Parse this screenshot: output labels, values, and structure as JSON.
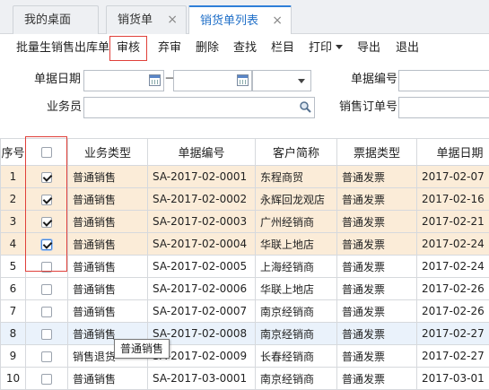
{
  "tabs": [
    {
      "label": "我的桌面"
    },
    {
      "label": "销货单",
      "close": "×"
    },
    {
      "label": "销货单列表",
      "close": "×"
    }
  ],
  "toolbar": {
    "batch_out": "批量生销售出库单",
    "audit": "审核",
    "abandon": "弃审",
    "delete": "删除",
    "find": "查找",
    "columns": "栏目",
    "print": "打印",
    "export": "导出",
    "exit": "退出"
  },
  "search": {
    "date_label": "单据日期",
    "date_sep": "－",
    "bill_no_label": "单据编号",
    "salesman_label": "业务员",
    "order_no_label": "销售订单号"
  },
  "grid": {
    "headers": [
      "序号",
      "",
      "业务类型",
      "单据编号",
      "客户简称",
      "票据类型",
      "单据日期"
    ],
    "rows": [
      {
        "no": "1",
        "checked": true,
        "type": "普通销售",
        "bill": "SA-2017-02-0001",
        "customer": "东程商贸",
        "invoice": "普通发票",
        "date": "2017-02-07"
      },
      {
        "no": "2",
        "checked": true,
        "type": "普通销售",
        "bill": "SA-2017-02-0002",
        "customer": "永辉回龙观店",
        "invoice": "普通发票",
        "date": "2017-02-16"
      },
      {
        "no": "3",
        "checked": true,
        "type": "普通销售",
        "bill": "SA-2017-02-0003",
        "customer": "广州经销商",
        "invoice": "普通发票",
        "date": "2017-02-21"
      },
      {
        "no": "4",
        "checked": true,
        "type": "普通销售",
        "bill": "SA-2017-02-0004",
        "customer": "华联上地店",
        "invoice": "普通发票",
        "date": "2017-02-24"
      },
      {
        "no": "5",
        "checked": false,
        "type": "普通销售",
        "bill": "SA-2017-02-0005",
        "customer": "上海经销商",
        "invoice": "普通发票",
        "date": "2017-02-24"
      },
      {
        "no": "6",
        "checked": false,
        "type": "普通销售",
        "bill": "SA-2017-02-0006",
        "customer": "华联上地店",
        "invoice": "普通发票",
        "date": "2017-02-26"
      },
      {
        "no": "7",
        "checked": false,
        "type": "普通销售",
        "bill": "SA-2017-02-0007",
        "customer": "南京经销商",
        "invoice": "普通发票",
        "date": "2017-02-26"
      },
      {
        "no": "8",
        "checked": false,
        "type": "普通销售",
        "bill": "SA-2017-02-0008",
        "customer": "南京经销商",
        "invoice": "普通发票",
        "date": "2017-02-27"
      },
      {
        "no": "9",
        "checked": false,
        "type": "销售退货",
        "bill": "SA-2017-02-0009",
        "customer": "长春经销商",
        "invoice": "普通发票",
        "date": "2017-02-27"
      },
      {
        "no": "10",
        "checked": false,
        "type": "普通销售",
        "bill": "SA-2017-03-0001",
        "customer": "南京经销商",
        "invoice": "普通发票",
        "date": "2017-03-01"
      }
    ]
  },
  "tooltip": "普通销售",
  "colors": {
    "accent": "#2f7fd8",
    "highlight": "#e0403a",
    "selected_row": "#fbecd8",
    "hover_row": "#eaf2fb"
  }
}
